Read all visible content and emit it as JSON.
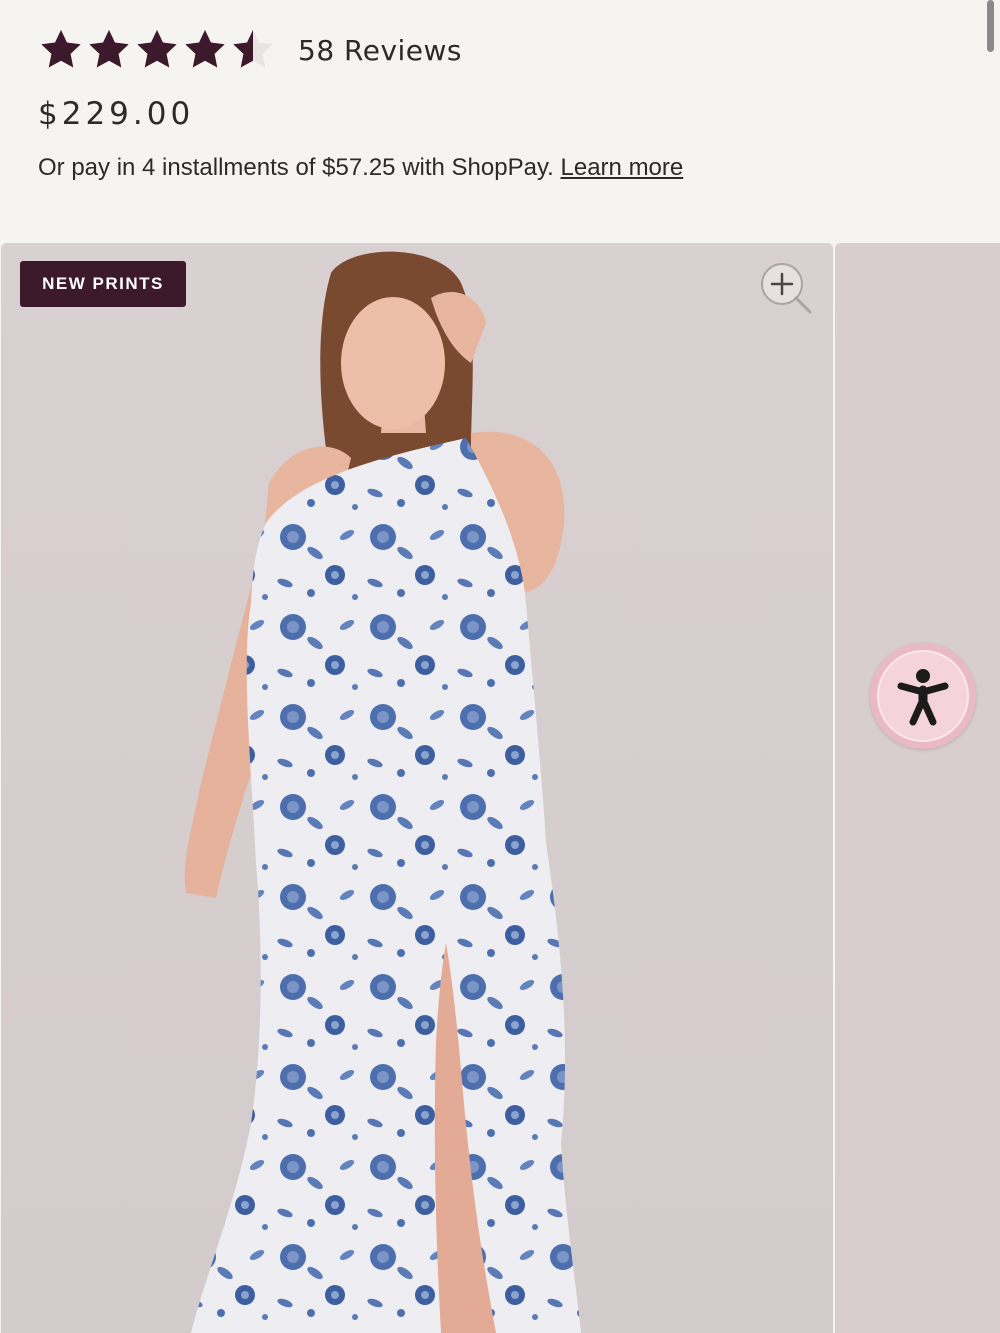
{
  "product": {
    "rating": 4.5,
    "rating_max": 5,
    "reviews_label": "58 Reviews",
    "price": "$229.00",
    "installments_text": "Or pay in 4 installments of $57.25 with ShopPay.",
    "learn_more_label": "Learn more"
  },
  "gallery": {
    "badge_label": "NEW PRINTS",
    "zoom_icon": "zoom-in-icon",
    "accessibility_icon": "accessibility-person-icon"
  },
  "colors": {
    "star_filled": "#3d1a2b",
    "star_empty": "#e6e5e3",
    "badge_bg": "#3d1a2b",
    "accessibility_bg": "#eab9c6"
  }
}
